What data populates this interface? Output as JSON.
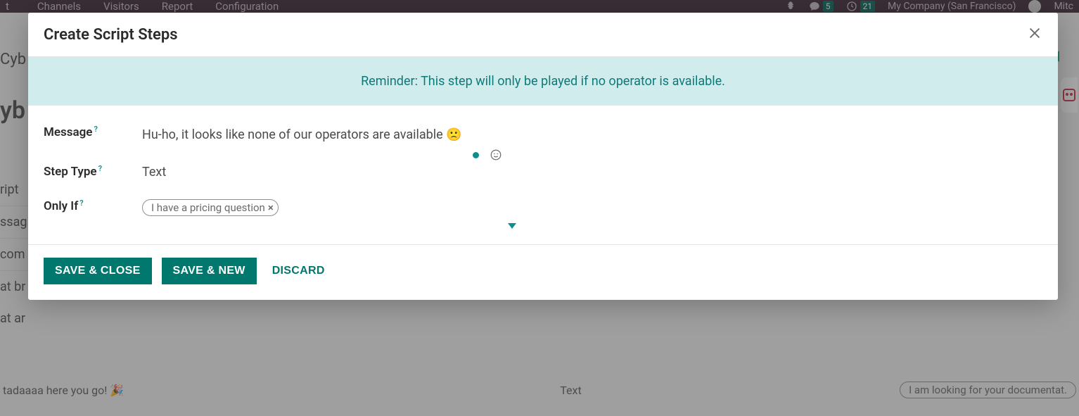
{
  "topbar": {
    "menu": [
      "Channels",
      "Visitors",
      "Report",
      "Configuration"
    ],
    "msg_count": "5",
    "clock_count": "21",
    "company": "My Company (San Francisco)",
    "user": "Mitc"
  },
  "background": {
    "heading1": "Cyb",
    "heading2": "yb",
    "row_script": "ript",
    "row_msg": "ssag",
    "row_com": "com",
    "row_at_br": "at br",
    "row_at_ar": "at ar",
    "bottom_left": "tadaaaa here you go! 🎉",
    "bottom_mid": "Text",
    "bottom_pill": "I am looking for your documentat."
  },
  "modal": {
    "title": "Create Script Steps",
    "reminder": "Reminder: This step will only be played if no operator is available.",
    "labels": {
      "message": "Message",
      "step_type": "Step Type",
      "only_if": "Only If"
    },
    "values": {
      "message": "Hu-ho, it looks like none of our operators are available 🙁",
      "step_type": "Text",
      "only_if_tag": "I have a pricing question"
    },
    "buttons": {
      "save_close": "Save & Close",
      "save_new": "Save & New",
      "discard": "Discard"
    }
  }
}
